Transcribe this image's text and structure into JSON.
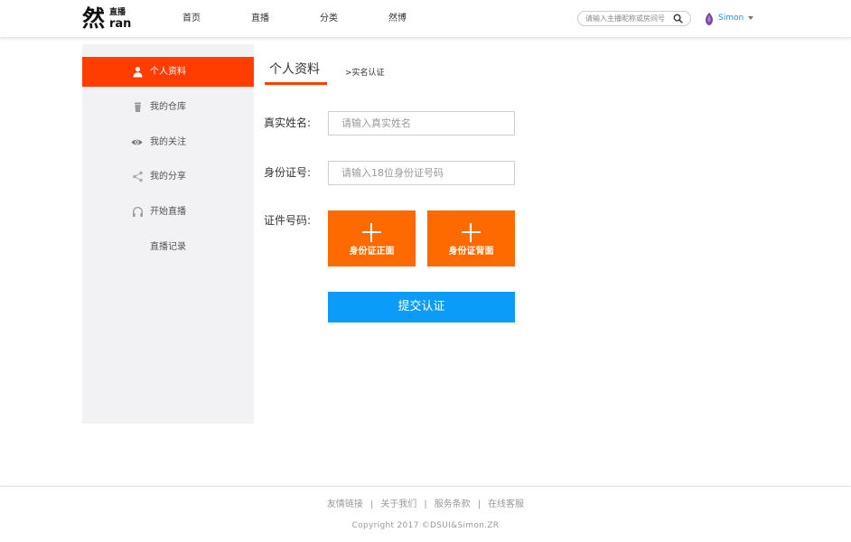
{
  "header": {
    "logo_main": "然",
    "logo_small": "直播",
    "logo_ran": "ran",
    "nav": [
      "首页",
      "直播",
      "分类",
      "然博"
    ],
    "search_placeholder": "请输入主播昵称或房间号",
    "username": "Simon"
  },
  "sidebar": {
    "items": [
      {
        "label": "个人资料",
        "icon": "user-icon",
        "active": true
      },
      {
        "label": "我的仓库",
        "icon": "trash-icon",
        "active": false
      },
      {
        "label": "我的关注",
        "icon": "eye-icon",
        "active": false
      },
      {
        "label": "我的分享",
        "icon": "share-icon",
        "active": false
      },
      {
        "label": "开始直播",
        "icon": "headphones-icon",
        "active": false
      },
      {
        "label": "直播记录",
        "icon": "",
        "active": false
      }
    ]
  },
  "main": {
    "tab_title": "个人资料",
    "tab_sub": ">实名认证",
    "fields": {
      "name_label": "真实姓名:",
      "name_placeholder": "请输入真实姓名",
      "id_label": "身份证号:",
      "id_placeholder": "请输入18位身份证号码",
      "doc_label": "证件号码:"
    },
    "uploads": [
      "身份证正面",
      "身份证背面"
    ],
    "submit_label": "提交认证"
  },
  "footer": {
    "links": [
      "友情链接",
      "关于我们",
      "服务条款",
      "在线客服"
    ],
    "separator": "|",
    "copyright": "Copyright 2017 ©DSUI&Simon.ZR"
  },
  "colors": {
    "accent": "#ff3d00",
    "upload_bg": "#ff6a00",
    "submit_bg": "#0a9cf8",
    "username": "#2a8ee6"
  }
}
